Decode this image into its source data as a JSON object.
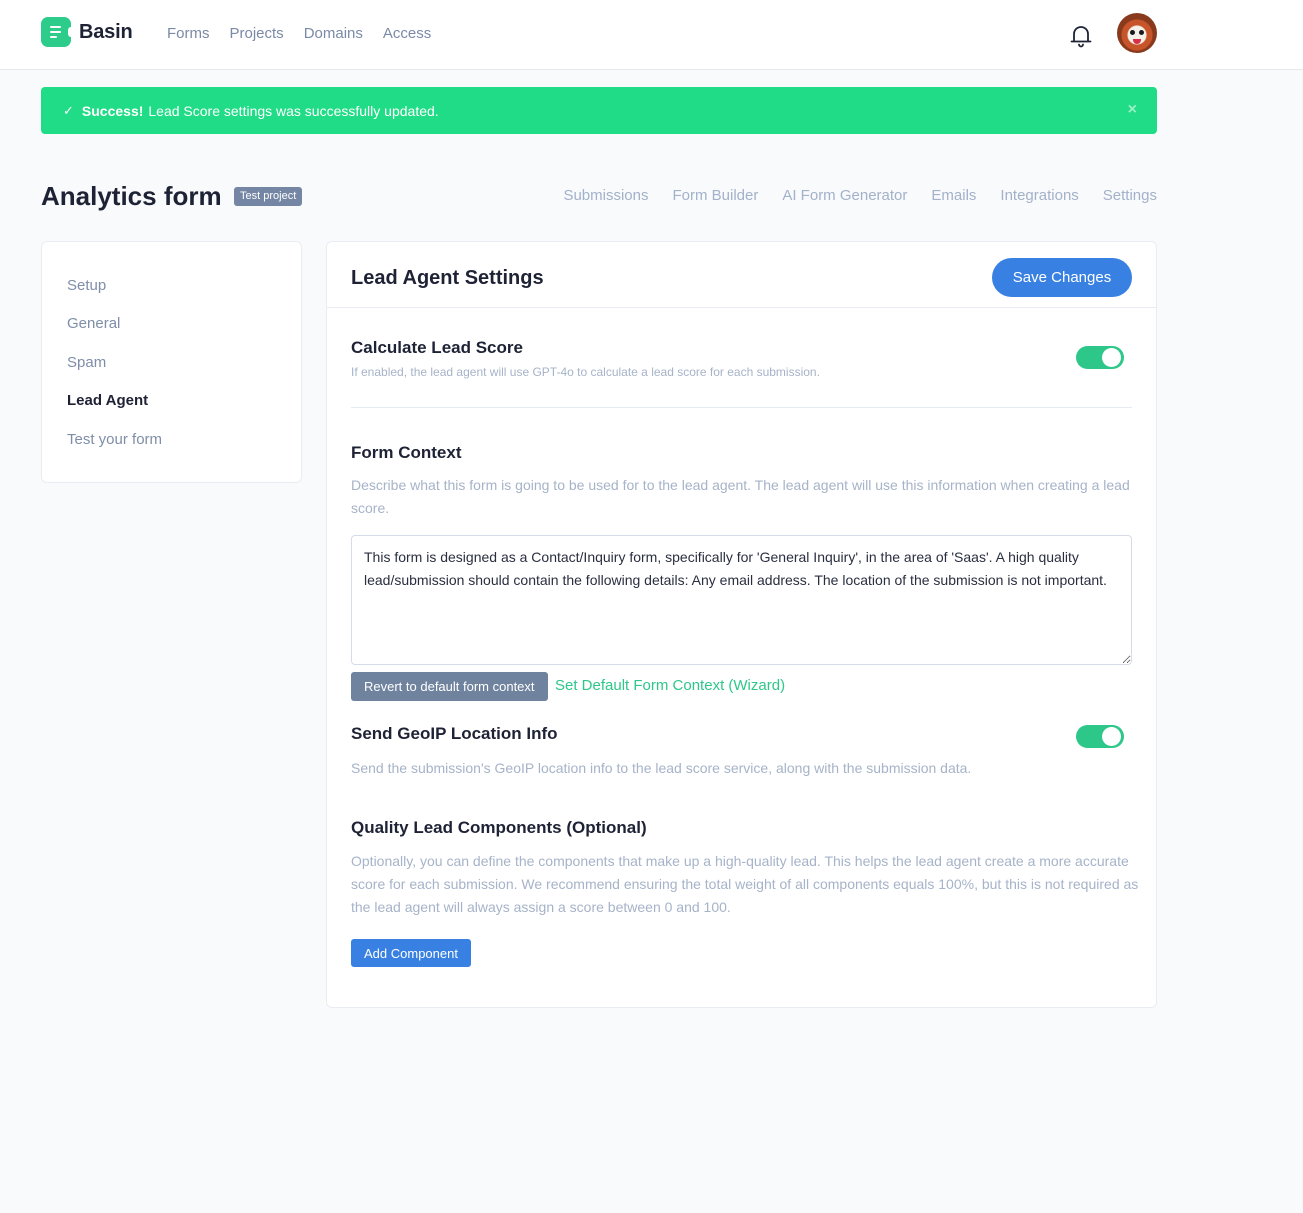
{
  "app": {
    "brand": "Basin",
    "nav": [
      "Forms",
      "Projects",
      "Domains",
      "Access"
    ],
    "icons": {
      "notifications": "bell-icon",
      "avatar": "user-avatar"
    }
  },
  "alert": {
    "icon": "check-icon",
    "title": "Success!",
    "message": "Lead Score settings was successfully updated.",
    "close": "×",
    "color": "#20dc86"
  },
  "page": {
    "title": "Analytics form",
    "badge": "Test project",
    "tabs": [
      "Submissions",
      "Form Builder",
      "AI Form Generator",
      "Emails",
      "Integrations",
      "Settings"
    ]
  },
  "sidebar": {
    "items": [
      {
        "label": "Setup",
        "active": false
      },
      {
        "label": "General",
        "active": false
      },
      {
        "label": "Spam",
        "active": false
      },
      {
        "label": "Lead Agent",
        "active": true
      },
      {
        "label": "Test your form",
        "active": false
      }
    ]
  },
  "settings": {
    "title": "Lead Agent Settings",
    "save_label": "Save Changes",
    "calculate": {
      "title": "Calculate Lead Score",
      "description": "If enabled, the lead agent will use GPT-4o to calculate a lead score for each submission.",
      "enabled": true
    },
    "context": {
      "title": "Form Context",
      "description": "Describe what this form is going to be used for to the lead agent. The lead agent will use this information when creating a lead score.",
      "value": "This form is designed as a Contact/Inquiry form, specifically for 'General Inquiry', in the area of 'Saas'. A high quality lead/submission should contain the following details: Any email address. The location of the submission is not important.",
      "revert_label": "Revert to default form context",
      "wizard_label": "Set Default Form Context (Wizard)"
    },
    "geoip": {
      "title": "Send GeoIP Location Info",
      "description": "Send the submission's GeoIP location info to the lead score service, along with the submission data.",
      "enabled": true
    },
    "components": {
      "title": "Quality Lead Components (Optional)",
      "description": "Optionally, you can define the components that make up a high-quality lead. This helps the lead agent create a more accurate score for each submission. We recommend ensuring the total weight of all components equals 100%, but this is not required as the lead agent will always assign a score between 0 and 100.",
      "add_label": "Add Component"
    },
    "colors": {
      "primary": "#3880e1",
      "toggle_on": "#2ec78a",
      "secondary": "#6f829e"
    }
  }
}
